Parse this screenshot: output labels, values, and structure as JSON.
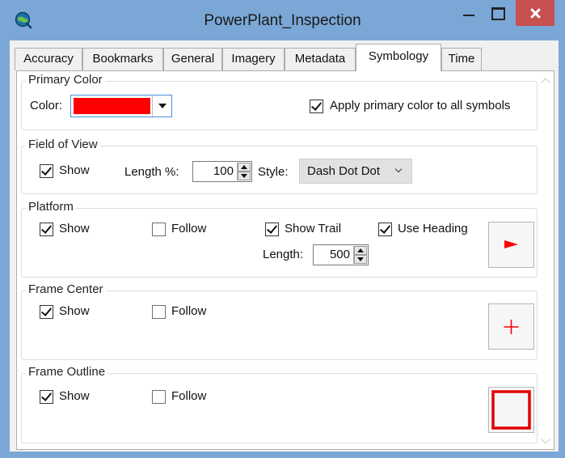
{
  "window": {
    "title": "PowerPlant_Inspection",
    "icon": "globe-icon",
    "controls": [
      "minimize-icon",
      "maximize-icon",
      "close-icon"
    ]
  },
  "tabs": [
    {
      "label": "Accuracy",
      "active": false
    },
    {
      "label": "Bookmarks",
      "active": false
    },
    {
      "label": "General",
      "active": false
    },
    {
      "label": "Imagery",
      "active": false
    },
    {
      "label": "Metadata",
      "active": false
    },
    {
      "label": "Symbology",
      "active": true
    },
    {
      "label": "Time",
      "active": false
    }
  ],
  "primary_color": {
    "legend": "Primary Color",
    "color_label": "Color:",
    "color_value": "#ff0000",
    "apply_all_label": "Apply primary color to all symbols",
    "apply_all_checked": true
  },
  "field_of_view": {
    "legend": "Field of View",
    "show_label": "Show",
    "show_checked": true,
    "length_label": "Length %:",
    "length_value": "100",
    "style_label": "Style:",
    "style_value": "Dash Dot Dot"
  },
  "platform": {
    "legend": "Platform",
    "show_label": "Show",
    "show_checked": true,
    "follow_label": "Follow",
    "follow_checked": false,
    "show_trail_label": "Show Trail",
    "show_trail_checked": true,
    "use_heading_label": "Use Heading",
    "use_heading_checked": true,
    "length_label": "Length:",
    "length_value": "500",
    "symbol_icon": "red-flag-icon"
  },
  "frame_center": {
    "legend": "Frame Center",
    "show_label": "Show",
    "show_checked": true,
    "follow_label": "Follow",
    "follow_checked": false,
    "symbol_icon": "red-crosshair-icon"
  },
  "frame_outline": {
    "legend": "Frame Outline",
    "show_label": "Show",
    "show_checked": true,
    "follow_label": "Follow",
    "follow_checked": false,
    "symbol_icon": "red-square-outline-icon"
  },
  "colors": {
    "titlebar": "#7aa7d6",
    "close_button": "#c75050",
    "accent_red": "#ff0000"
  }
}
